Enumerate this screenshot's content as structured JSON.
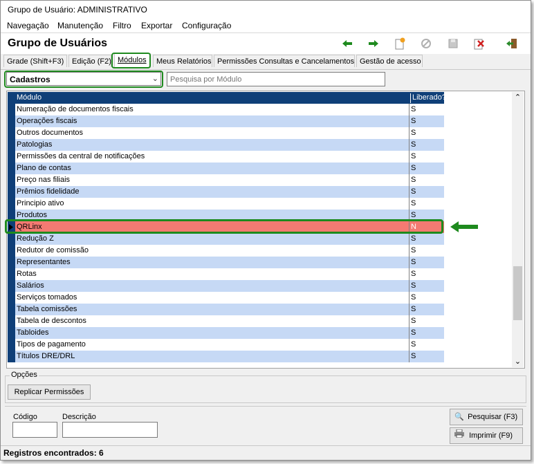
{
  "window": {
    "title": "Grupo de Usuário: ADMINISTRATIVO"
  },
  "menu": [
    {
      "label": "Navegação"
    },
    {
      "label": "Manutenção"
    },
    {
      "label": "Filtro"
    },
    {
      "label": "Exportar"
    },
    {
      "label": "Configuração"
    }
  ],
  "header": {
    "title": "Grupo de Usuários"
  },
  "toolbar": {
    "icons": [
      "arrow-left-icon",
      "arrow-right-icon",
      "new-icon",
      "cancel-icon",
      "save-icon",
      "delete-icon",
      "exit-icon"
    ],
    "colors": {
      "nav": "#1e8a1e",
      "new": "#f0a020",
      "delete": "#d02020",
      "exit": "#2a8a2a"
    }
  },
  "tabs": [
    {
      "label": "Grade (Shift+F3)"
    },
    {
      "label": "Edição (F2)"
    },
    {
      "label": "Módulos"
    },
    {
      "label": "Meus Relatórios"
    },
    {
      "label": "Permissões Consultas e Cancelamentos"
    },
    {
      "label": "Gestão de acesso"
    }
  ],
  "filter": {
    "category": "Cadastros",
    "search_placeholder": "Pesquisa por Módulo"
  },
  "grid": {
    "columns": [
      "Módulo",
      "Liberado?"
    ],
    "rows": [
      {
        "module": "Numeração de documentos fiscais",
        "allowed": "S"
      },
      {
        "module": "Operações fiscais",
        "allowed": "S"
      },
      {
        "module": "Outros documentos",
        "allowed": "S"
      },
      {
        "module": "Patologias",
        "allowed": "S"
      },
      {
        "module": "Permissões da central de notificações",
        "allowed": "S"
      },
      {
        "module": "Plano de contas",
        "allowed": "S"
      },
      {
        "module": "Preço nas filiais",
        "allowed": "S"
      },
      {
        "module": "Prêmios fidelidade",
        "allowed": "S"
      },
      {
        "module": "Principio ativo",
        "allowed": "S"
      },
      {
        "module": "Produtos",
        "allowed": "S"
      },
      {
        "module": "QRLinx",
        "allowed": "N"
      },
      {
        "module": "Redução Z",
        "allowed": "S"
      },
      {
        "module": "Redutor de comissão",
        "allowed": "S"
      },
      {
        "module": "Representantes",
        "allowed": "S"
      },
      {
        "module": "Rotas",
        "allowed": "S"
      },
      {
        "module": "Salários",
        "allowed": "S"
      },
      {
        "module": "Serviços tomados",
        "allowed": "S"
      },
      {
        "module": "Tabela comissões",
        "allowed": "S"
      },
      {
        "module": "Tabela de descontos",
        "allowed": "S"
      },
      {
        "module": "Tabloides",
        "allowed": "S"
      },
      {
        "module": "Tipos de pagamento",
        "allowed": "S"
      },
      {
        "module": "Títulos DRE/DRL",
        "allowed": "S"
      }
    ]
  },
  "options": {
    "legend": "Opções",
    "replicate_button": "Replicar Permissões"
  },
  "filters": {
    "code_label": "Código",
    "description_label": "Descrição",
    "search_button": "Pesquisar (F3)",
    "print_button": "Imprimir (F9)"
  },
  "status": {
    "records": "Registros encontrados: 6"
  },
  "colors": {
    "header_bg": "#0f3f78",
    "row_alt": "#c6d9f5",
    "row_selected": "#f47a72",
    "highlight": "#1e8a1e"
  }
}
